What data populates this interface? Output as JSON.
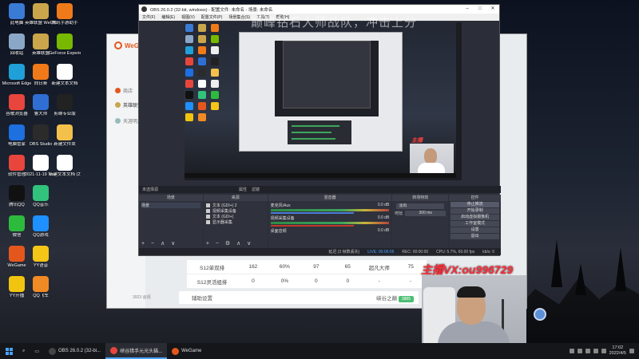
{
  "desktop": {
    "col1": [
      {
        "label": "此电脑",
        "color": "#3a7bd5"
      },
      {
        "label": "回收站",
        "color": "#8aa7c7"
      },
      {
        "label": "Microsoft Edge",
        "color": "#1fa0d8"
      },
      {
        "label": "谷歌浏览器",
        "color": "#e8453c"
      },
      {
        "label": "电脑管家",
        "color": "#1e6fe0"
      },
      {
        "label": "软件管理",
        "color": "#e8453c"
      },
      {
        "label": "腾讯QQ",
        "color": "#111111"
      },
      {
        "label": "微信",
        "color": "#2dbb3e"
      },
      {
        "label": "WeGame",
        "color": "#e4571c"
      },
      {
        "label": "YY开播",
        "color": "#f1c40f"
      }
    ],
    "col2": [
      {
        "label": "英雄联盟 WeGame版",
        "color": "#c9a64b"
      },
      {
        "label": "英雄联盟",
        "color": "#c9a64b"
      },
      {
        "label": "向日葵",
        "color": "#f07a1a"
      },
      {
        "label": "鲁大师",
        "color": "#2f6fd3"
      },
      {
        "label": "OBS Studio",
        "color": "#2b2b2b"
      },
      {
        "label": "2021-11-19 Team Ali...",
        "color": "#ffffff"
      },
      {
        "label": "QQ音乐",
        "color": "#31c27c"
      },
      {
        "label": "QQ游戏",
        "color": "#1e90ff"
      },
      {
        "label": "YY语音",
        "color": "#f5c518"
      },
      {
        "label": "QQ飞车",
        "color": "#f08a24"
      }
    ],
    "col3": [
      {
        "label": "腾讯手游助手",
        "color": "#f07a1a"
      },
      {
        "label": "GeForce Experience",
        "color": "#76b900"
      },
      {
        "label": "新建文本文档",
        "color": "#ffffff"
      },
      {
        "label": "剪映专业版",
        "color": "#222222"
      },
      {
        "label": "新建文件夹",
        "color": "#f3c14b"
      },
      {
        "label": "新建文本文档 (2)",
        "color": "#ffffff"
      }
    ]
  },
  "wegame": {
    "logo": "WeGame",
    "nav": [
      "商店",
      "英雄联盟",
      "天涯明月刀"
    ],
    "table_rows": [
      [
        "S12单双排",
        "162",
        "60%",
        "97",
        "65",
        "超凡大师",
        "75"
      ],
      [
        "S12灵活组排",
        "0",
        "0%",
        "0",
        "0",
        "-",
        "-"
      ]
    ],
    "bottom_bar": {
      "left": "辅助设置",
      "right": "峡谷之巅",
      "badge": "3885"
    },
    "version": "3923 @视"
  },
  "obs": {
    "title": "OBS 26.0.2 (32-bit, windows) - 配置文件: 未命名 - 场景: 未命名",
    "menu": [
      "文件(F)",
      "编辑(E)",
      "视图(V)",
      "配置文件(P)",
      "场景集合(S)",
      "工具(T)",
      "帮助(H)"
    ],
    "overlay_title": "巅峰钻石大师战队，冲击上分",
    "preview_watermark": "主播VX:ou996729",
    "status_strip": [
      "未选择源",
      "属性",
      "滤镜"
    ],
    "panels": {
      "scenes": {
        "header": "场景",
        "items": [
          "场景"
        ]
      },
      "sources": {
        "header": "来源",
        "items": [
          "文本 (GDI+) 2",
          "视频采集设备",
          "文本 (GDI+)",
          "显示器采集"
        ]
      },
      "mixer": {
        "header": "混音器",
        "tracks": [
          {
            "name": "麦克风/Aux",
            "level": "0.0 dB"
          },
          {
            "name": "视频采集设备",
            "level": "0.0 dB"
          },
          {
            "name": "桌面音频",
            "level": "0.0 dB"
          }
        ]
      },
      "transitions": {
        "header": "转场特效",
        "mode": "淡出",
        "duration_label": "时长",
        "duration": "300 ms"
      },
      "controls": {
        "header": "控件",
        "buttons": [
          "停止推流",
          "开始录制",
          "启动虚拟摄像机",
          "工作室模式",
          "设置",
          "退出"
        ]
      }
    },
    "footer": {
      "live": "LIVE: 00:06:06",
      "rec": "REC: 00:00:00",
      "cpu": "CPU: 5.7%, 60.00 fps",
      "drops": "延迟 (3 帧数丢失)",
      "bitrate": "kb/s: 0"
    }
  },
  "overlay": {
    "vx": "主播VX:ou996729"
  },
  "taskbar": {
    "items": [
      {
        "label": "OBS 26.0.2 (32-bi...",
        "color": "#444444",
        "active": false
      },
      {
        "label": "峡谷猎手元光头猫...",
        "color": "#e8453c",
        "active": true
      },
      {
        "label": "WeGame",
        "color": "#e4571c",
        "active": false
      }
    ],
    "time": "17:02",
    "date": "2022/4/5"
  }
}
